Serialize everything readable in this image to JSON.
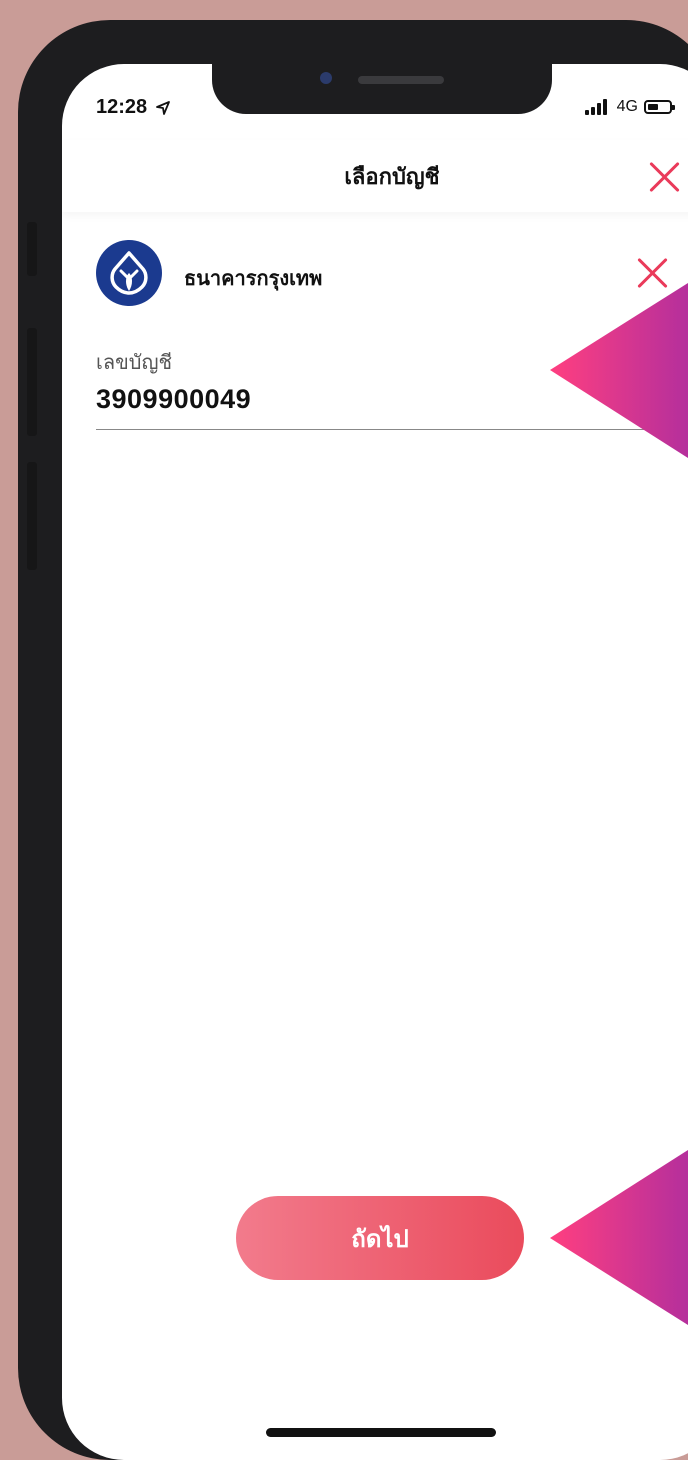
{
  "status_bar": {
    "time": "12:28",
    "network": "4G"
  },
  "header": {
    "title": "เลือกบัญชี"
  },
  "bank": {
    "name": "ธนาคารกรุงเทพ"
  },
  "account_field": {
    "label": "เลขบัญชี",
    "value": "3909900049"
  },
  "actions": {
    "next_label": "ถัดไป"
  },
  "colors": {
    "accent": "#ea3a5a",
    "bank_logo": "#1b3a8f",
    "pointer": "#e8306f"
  }
}
